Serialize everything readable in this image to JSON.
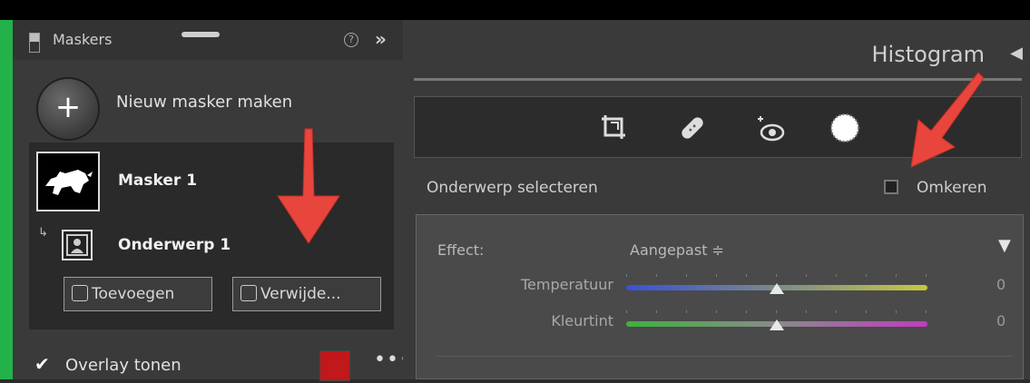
{
  "left_panel": {
    "title": "Maskers",
    "new_mask_label": "Nieuw masker maken",
    "mask_name": "Masker 1",
    "submask_name": "Onderwerp 1",
    "add_button": "Toevoegen",
    "delete_button": "Verwijde...",
    "overlay_label": "Overlay tonen",
    "overlay_color": "#c0181b",
    "more_label": "•••"
  },
  "right_panel": {
    "histogram_title": "Histogram",
    "select_subject_label": "Onderwerp selecteren",
    "invert_label": "Omkeren",
    "effect_label": "Effect:",
    "effect_value": "Aangepast ≑",
    "sliders": [
      {
        "label": "Temperatuur",
        "value": "0",
        "position": 0.5
      },
      {
        "label": "Kleurtint",
        "value": "0",
        "position": 0.5
      }
    ],
    "tools": [
      "crop-icon",
      "healing-icon",
      "redeye-icon",
      "mask-icon"
    ]
  },
  "colors": {
    "accent_green": "#23b24a",
    "annotation_red": "#e8453c"
  }
}
